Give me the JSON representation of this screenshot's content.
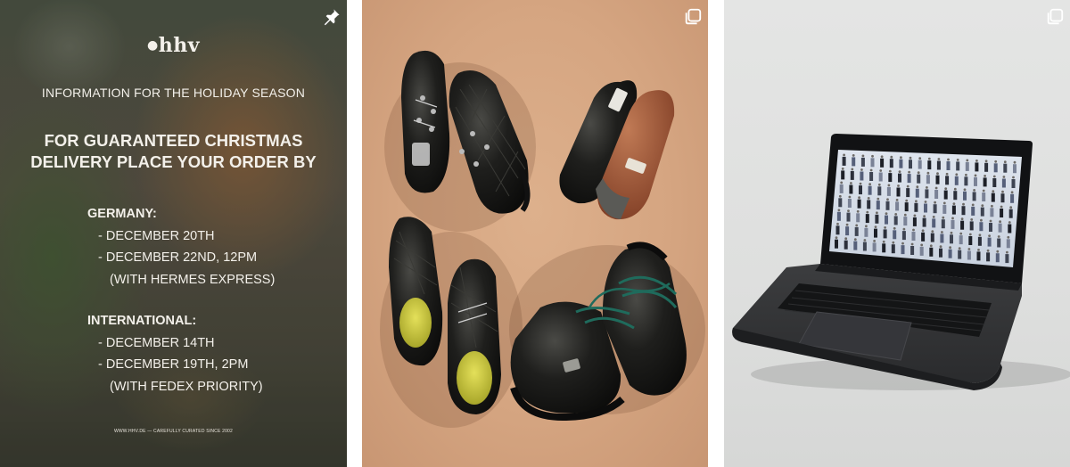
{
  "grid": {
    "tiles": [
      {
        "icon": "pin-icon"
      },
      {
        "icon": "multiple-images-icon"
      },
      {
        "icon": "multiple-images-icon"
      }
    ]
  },
  "post1": {
    "logo": "hhv",
    "heading": "INFORMATION FOR THE HOLIDAY SEASON",
    "deadline_line1": "FOR GUARANTEED CHRISTMAS",
    "deadline_line2": "DELIVERY PLACE YOUR ORDER BY",
    "germany": {
      "title": "GERMANY:",
      "line1": "- DECEMBER 20TH",
      "line2": "- DECEMBER 22ND, 12PM",
      "line3": "(WITH HERMES EXPRESS)"
    },
    "international": {
      "title": "INTERNATIONAL:",
      "line1": "- DECEMBER 14TH",
      "line2": "- DECEMBER 19TH, 2PM",
      "line3": "(WITH FEDEX PRIORITY)"
    },
    "footer": "WWW.HHV.DE — CAREFULLY CURATED SINCE 2002"
  },
  "colors": {
    "background": "#ffffff",
    "shoe_backdrop": "#d5a581",
    "laptop_backdrop": "#e2e3e2"
  }
}
